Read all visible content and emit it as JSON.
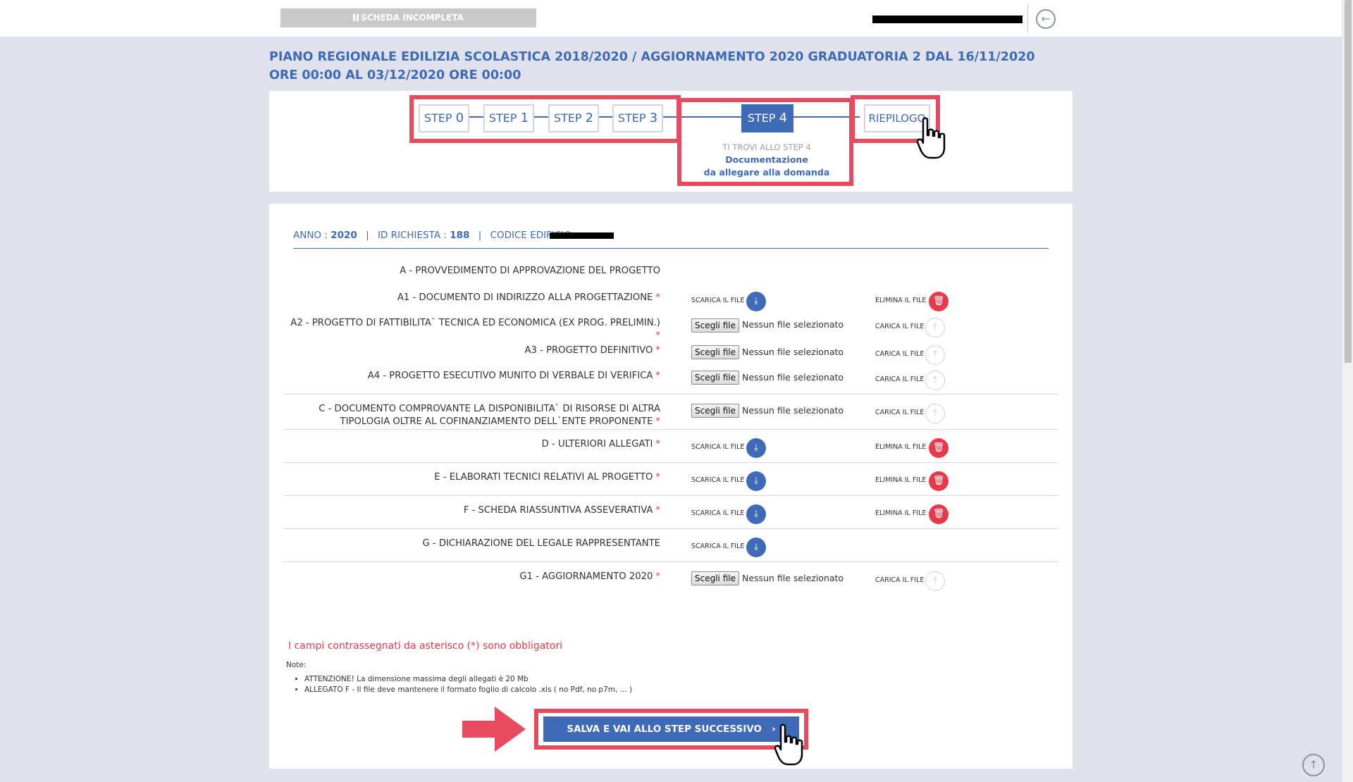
{
  "header": {
    "status_badge": "SCHEDA INCOMPLETA",
    "back_icon": "arrow-left-icon"
  },
  "page_title": "PIANO REGIONALE EDILIZIA SCOLASTICA 2018/2020 / AGGIORNAMENTO 2020 GRADUATORIA 2 DAL 16/11/2020 ORE 00:00 AL 03/12/2020 ORE 00:00",
  "steps": [
    {
      "label": "STEP",
      "num": "0"
    },
    {
      "label": "STEP",
      "num": "1"
    },
    {
      "label": "STEP",
      "num": "2"
    },
    {
      "label": "STEP",
      "num": "3"
    },
    {
      "label": "STEP",
      "num": "4"
    },
    {
      "label": "RIEPILOGO",
      "num": ""
    }
  ],
  "active_step": {
    "hint": "TI TROVI ALLO STEP 4",
    "title_line1": "Documentazione",
    "title_line2": "da allegare alla domanda"
  },
  "meta": {
    "anno_label": "ANNO :",
    "anno_value": "2020",
    "sep": "|",
    "id_label": "ID RICHIESTA :",
    "id_value": "188",
    "codice_label": "CODICE EDIFICIO"
  },
  "labels": {
    "download": "SCARICA IL FILE",
    "delete": "ELIMINA IL FILE",
    "upload": "CARICA IL FILE",
    "choose_file": "Scegli file",
    "no_file": "Nessun file selezionato",
    "required_mark": "*"
  },
  "documents": {
    "section_a": "A - PROVVEDIMENTO DI APPROVAZIONE DEL PROGETTO",
    "a1": "A1 - DOCUMENTO DI INDIRIZZO ALLA PROGETTAZIONE",
    "a2": "A2 - PROGETTO DI FATTIBILITA` TECNICA ED ECONOMICA (EX PROG. PRELIMIN.)",
    "a3": "A3 - PROGETTO DEFINITIVO",
    "a4": "A4 - PROGETTO ESECUTIVO MUNITO DI VERBALE DI VERIFICA",
    "c_line1": "C - DOCUMENTO COMPROVANTE LA DISPONIBILITA` DI RISORSE DI ALTRA",
    "c_line2": "TIPOLOGIA OLTRE AL COFINANZIAMENTO DELL`ENTE PROPONENTE",
    "d": "D - ULTERIORI ALLEGATI",
    "e": "E - ELABORATI TECNICI RELATIVI AL PROGETTO",
    "f": "F - SCHEDA RIASSUNTIVA ASSEVERATIVA",
    "g": "G - DICHIARAZIONE DEL LEGALE RAPPRESENTANTE",
    "g1": "G1 - AGGIORNAMENTO 2020"
  },
  "required_note": "I campi contrassegnati da asterisco (*) sono obbligatori",
  "notes": {
    "title": "Note:",
    "items": [
      "ATTENZIONE! La dimensione massima degli allegati è 20 Mb",
      "ALLEGATO F - Il file deve mantenere il formato foglio di calcolo .xls ( no Pdf, no p7m, ... )"
    ]
  },
  "submit": {
    "label": "SALVA E VAI ALLO STEP SUCCESSIVO",
    "chevron": "›"
  },
  "colors": {
    "primary": "#3e6ab7",
    "danger": "#e8394a",
    "highlight": "#e84a5f"
  }
}
